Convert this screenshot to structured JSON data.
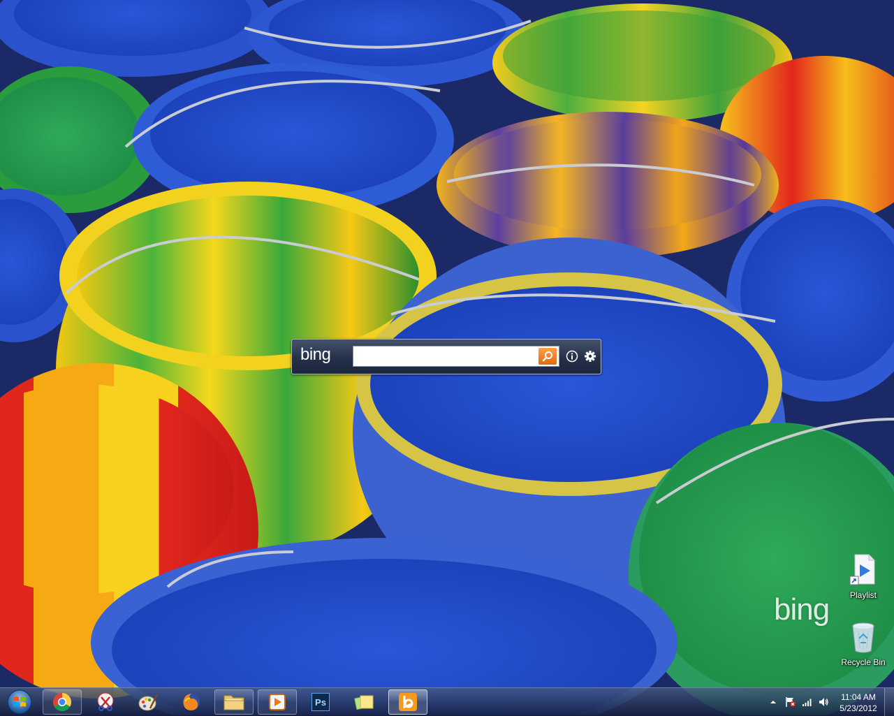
{
  "bing_bar": {
    "logo": "bing",
    "search": {
      "value": "",
      "placeholder": ""
    },
    "search_button": "search-icon",
    "info_button": "info-icon",
    "settings_button": "gear-icon",
    "accent_color": "#f07a20"
  },
  "desktop": {
    "icons": [
      {
        "label": "Playlist",
        "icon": "playlist-shortcut-icon"
      },
      {
        "label": "Recycle Bin",
        "icon": "recycle-bin-icon"
      }
    ],
    "watermark": "bing"
  },
  "taskbar": {
    "start": "windows-start-orb",
    "buttons": [
      {
        "name": "chrome",
        "icon": "chrome-icon",
        "state": "running"
      },
      {
        "name": "snipping-tool",
        "icon": "snipping-tool-icon",
        "state": "pinned"
      },
      {
        "name": "paint",
        "icon": "paint-icon",
        "state": "pinned"
      },
      {
        "name": "firefox",
        "icon": "firefox-icon",
        "state": "pinned"
      },
      {
        "name": "windows-explorer",
        "icon": "folder-icon",
        "state": "running"
      },
      {
        "name": "media-player",
        "icon": "media-player-icon",
        "state": "running"
      },
      {
        "name": "photoshop",
        "icon": "photoshop-icon",
        "label": "Ps",
        "state": "pinned"
      },
      {
        "name": "sticky-notes",
        "icon": "sticky-notes-icon",
        "state": "pinned"
      },
      {
        "name": "bing-desktop",
        "icon": "bing-b-icon",
        "state": "active"
      }
    ],
    "clock": {
      "time": "11:04 AM",
      "date": "5/23/2012"
    }
  }
}
